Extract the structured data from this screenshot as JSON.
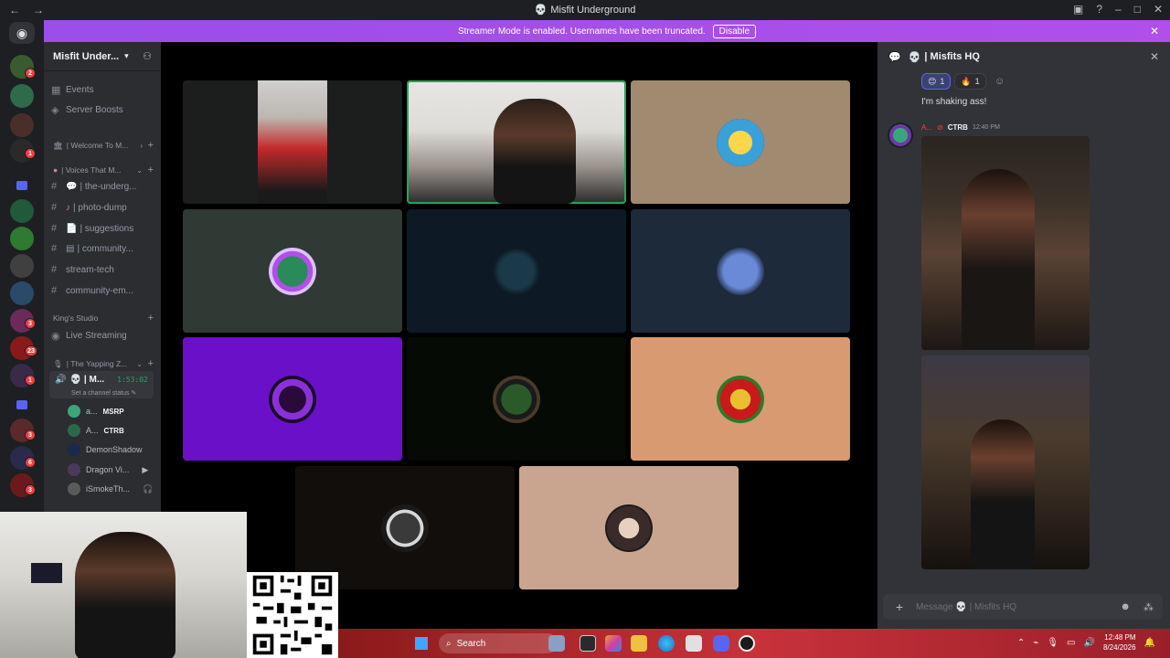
{
  "titlebar": {
    "title": "Misfit Underground",
    "back": "←",
    "forward": "→"
  },
  "banner": {
    "text": "Streamer Mode is enabled. Usernames have been truncated.",
    "disable_label": "Disable"
  },
  "server": {
    "name": "Misfit Under...",
    "items": [
      {
        "icon": "calendar-icon",
        "label": "Events"
      },
      {
        "icon": "boost-icon",
        "label": "Server Boosts"
      }
    ],
    "categories": [
      {
        "label": "| Welcome To M..."
      },
      {
        "label": "| Voices That M..."
      },
      {
        "label": "King's Studio"
      },
      {
        "label": "| The Yapping Z..."
      }
    ],
    "channels": [
      {
        "label": "| the-underg..."
      },
      {
        "label": "| photo-dump"
      },
      {
        "label": "| suggestions"
      },
      {
        "label": "| community..."
      },
      {
        "label": "stream-tech"
      },
      {
        "label": "community-em..."
      },
      {
        "label": "Live Streaming"
      }
    ],
    "active_voice": {
      "label": "| M...",
      "timer": "1:53:02",
      "status": "Set a channel status"
    },
    "voice_users": [
      {
        "name": "a...",
        "tag": "MSRP"
      },
      {
        "name": "A...",
        "tag": "CTRB"
      },
      {
        "name": "DemonShadow",
        "tag": ""
      },
      {
        "name": "Dragon Vi...",
        "tag": ""
      },
      {
        "name": "iSmokeTh...",
        "tag": ""
      }
    ]
  },
  "rail": {
    "badges": [
      "2",
      "1",
      "3",
      "23",
      "1",
      "3",
      "6",
      "3"
    ]
  },
  "chat": {
    "channel": "| Misfits HQ",
    "reactions": [
      {
        "emoji": "😊",
        "count": "1"
      },
      {
        "emoji": "🔥",
        "count": "1"
      }
    ],
    "message_text": "I'm shaking ass!",
    "author": "A...",
    "author_tag": "CTRB",
    "time": "12:40 PM",
    "placeholder": "Message 💀 | Misfits HQ"
  },
  "taskbar": {
    "search": "Search",
    "time": "12:48 PM",
    "date": "8/24/2026"
  },
  "colors": {
    "accent": "#5865f2",
    "banner": "#a84ee8",
    "speaking": "#23a55a",
    "badge": "#f23f43"
  }
}
